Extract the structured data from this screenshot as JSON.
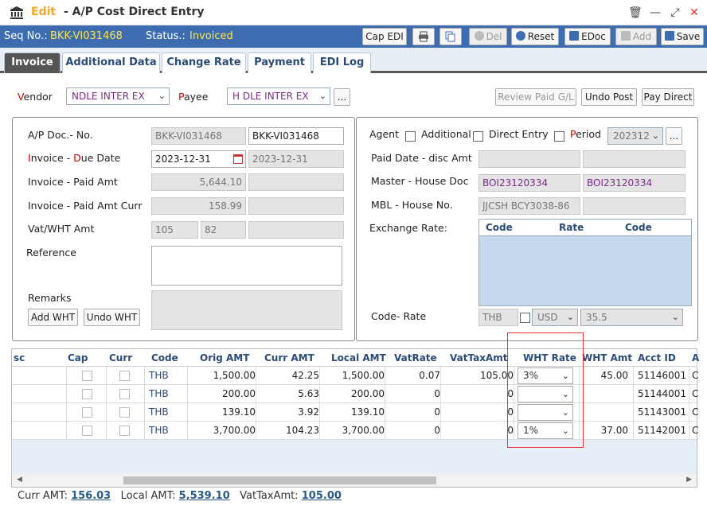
{
  "window": {
    "title_prefix": "Edit",
    "title": "- A/P Cost Direct Entry",
    "close_label": "✕",
    "maximize_label": "⤢",
    "minimize_label": "—",
    "trash_label": "🗑"
  },
  "statusbar": {
    "seq_label": "Seq No.:",
    "seq_value": "BKK-VI031468",
    "status_label": "Status.:",
    "status_value": "Invoiced"
  },
  "toolbar": {
    "cap_edi": "Cap EDI",
    "del": "Del",
    "reset": "Reset",
    "edoc": "EDoc",
    "add": "Add",
    "save": "Save"
  },
  "tabs": [
    "Invoice",
    "Additional Data",
    "Change Rate",
    "Payment",
    "EDI Log"
  ],
  "top": {
    "vendor_label_r": "V",
    "vendor_label": "endor",
    "vendor_value": "NDLE INTER EX",
    "payee_label_r": "P",
    "payee_label": "ayee",
    "payee_value": "H   DLE INTER EX",
    "more": "...",
    "review_paid": "Review Paid G/L",
    "undo_post": "Undo Post",
    "pay_direct": "Pay Direct"
  },
  "left": {
    "ap_doc_label": "A/P Doc.- No.",
    "ap_doc_1": "BKK-VI031468",
    "ap_doc_2": "BKK-VI031468",
    "inv_due_label_r1": "I",
    "inv_due_label_1": "nvoice - ",
    "inv_due_label_r2": "D",
    "inv_due_label_2": "ue Date",
    "inv_date": "2023-12-31",
    "due_date": "2023-12-31",
    "paid_amt_label": "Invoice - Paid Amt",
    "paid_amt": "5,644.10",
    "paid_curr_label": "Invoice - Paid Amt Curr",
    "paid_curr": "158.99",
    "vat_label": "Vat/WHT Amt",
    "vat_1": "105",
    "vat_2": "82",
    "reference_label": "Reference",
    "remarks_label": "Remarks",
    "add_wht": "Add WHT",
    "undo_wht": "Undo WHT"
  },
  "right": {
    "agent": "Agent",
    "additional": "Additional",
    "direct_entry": "Direct Entry",
    "period_r": "P",
    "period": "eriod",
    "period_value": "202312",
    "paid_date_label": "Paid Date - disc Amt",
    "master_label": "Master - House Doc",
    "master_1": "BOI23120334",
    "master_2": "BOI23120334",
    "mbl_label": "MBL - House No.",
    "mbl_1": "JJCSH       BCY3038-86",
    "exch_label": "Exchange Rate:",
    "exch_cols": [
      "Code",
      "Rate",
      "Code"
    ],
    "code_rate_label": "Code- Rate",
    "cr_code": "THB",
    "cr_curr": "USD",
    "cr_rate": "35.5"
  },
  "grid": {
    "columns": [
      "sc",
      "Cap",
      "Curr",
      "Code",
      "Orig AMT",
      "Curr AMT",
      "Local AMT",
      "VatRate",
      "VatTaxAmt",
      "WHT Rate",
      "WHT Amt",
      "Acct ID",
      "A"
    ],
    "rows": [
      {
        "code": "THB",
        "orig": "1,500.00",
        "curr": "42.25",
        "local": "1,500.00",
        "vatrate": "0.07",
        "vattax": "105.00",
        "wht": "3%",
        "whtamt": "45.00",
        "acct": "51146001",
        "a": "C"
      },
      {
        "code": "THB",
        "orig": "200.00",
        "curr": "5.63",
        "local": "200.00",
        "vatrate": "0",
        "vattax": "0",
        "wht": "",
        "whtamt": "",
        "acct": "51144001",
        "a": "C"
      },
      {
        "code": "THB",
        "orig": "139.10",
        "curr": "3.92",
        "local": "139.10",
        "vatrate": "0",
        "vattax": "0",
        "wht": "",
        "whtamt": "",
        "acct": "51143001",
        "a": "C"
      },
      {
        "code": "THB",
        "orig": "3,700.00",
        "curr": "104.23",
        "local": "3,700.00",
        "vatrate": "0",
        "vattax": "0",
        "wht": "1%",
        "whtamt": "37.00",
        "acct": "51142001",
        "a": "C"
      }
    ]
  },
  "footer": {
    "curr_label": "Curr AMT:",
    "curr_value": "156.03",
    "local_label": "Local AMT:",
    "local_value": "5,539.10",
    "vat_label": "VatTaxAmt:",
    "vat_value": "105.00"
  },
  "colors": {
    "accent": "#3d6db0",
    "highlight": "#ffe44d",
    "title_accent": "#f5a623"
  }
}
